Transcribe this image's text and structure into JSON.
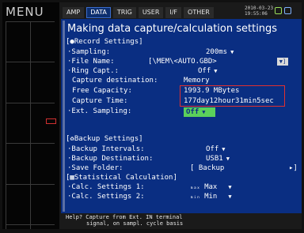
{
  "menu_title": "MENU",
  "tabs": [
    {
      "label": "AMP",
      "active": false
    },
    {
      "label": "DATA",
      "active": true
    },
    {
      "label": "TRIG",
      "active": false
    },
    {
      "label": "USER",
      "active": false
    },
    {
      "label": "I/F",
      "active": false
    },
    {
      "label": "OTHER",
      "active": false
    }
  ],
  "clock": {
    "date": "2010-03-23",
    "time": "19:55:06"
  },
  "title": "Making data capture/calculation settings",
  "record": {
    "header": "[●Record Settings]",
    "sampling_label": "·Sampling:",
    "sampling_value": "200ms",
    "file_name_label": "·File Name:",
    "file_name_value": "[\\MEM\\<AUTO.GBD>",
    "ring_capt_label": "·Ring Capt.:",
    "ring_capt_value": "Off",
    "capture_dest_label": "Capture destination:",
    "capture_dest_value": "Memory",
    "free_capacity_label": "Free Capacity:",
    "free_capacity_value": "1993.9 MBytes",
    "capture_time_label": "Capture Time:",
    "capture_time_value": "177day12hour31min5sec",
    "ext_sampling_label": "·Ext. Sampling:",
    "ext_sampling_value": "Off"
  },
  "backup": {
    "header": "[♻Backup Settings]",
    "intervals_label": "·Backup Intervals:",
    "intervals_value": "Off",
    "destination_label": "·Backup Destination:",
    "destination_value": "USB1",
    "save_folder_label": "·Save Folder:",
    "save_folder_value": "[ Backup"
  },
  "stats": {
    "header": "[▦Statistical Calculation]",
    "calc1_label": "·Calc. Settings 1:",
    "calc1_value": "Max",
    "calc2_label": "·Calc. Settings 2:",
    "calc2_value": "Min"
  },
  "help": {
    "line1": "Help? Capture from Ext. IN terminal",
    "line2": "signal, on sampl. cycle basis"
  },
  "colors": {
    "panel_bg": "#0a2e82",
    "highlight": "#e03030",
    "active_value": "#5bd05b",
    "tab_active": "#0d2f6e"
  }
}
